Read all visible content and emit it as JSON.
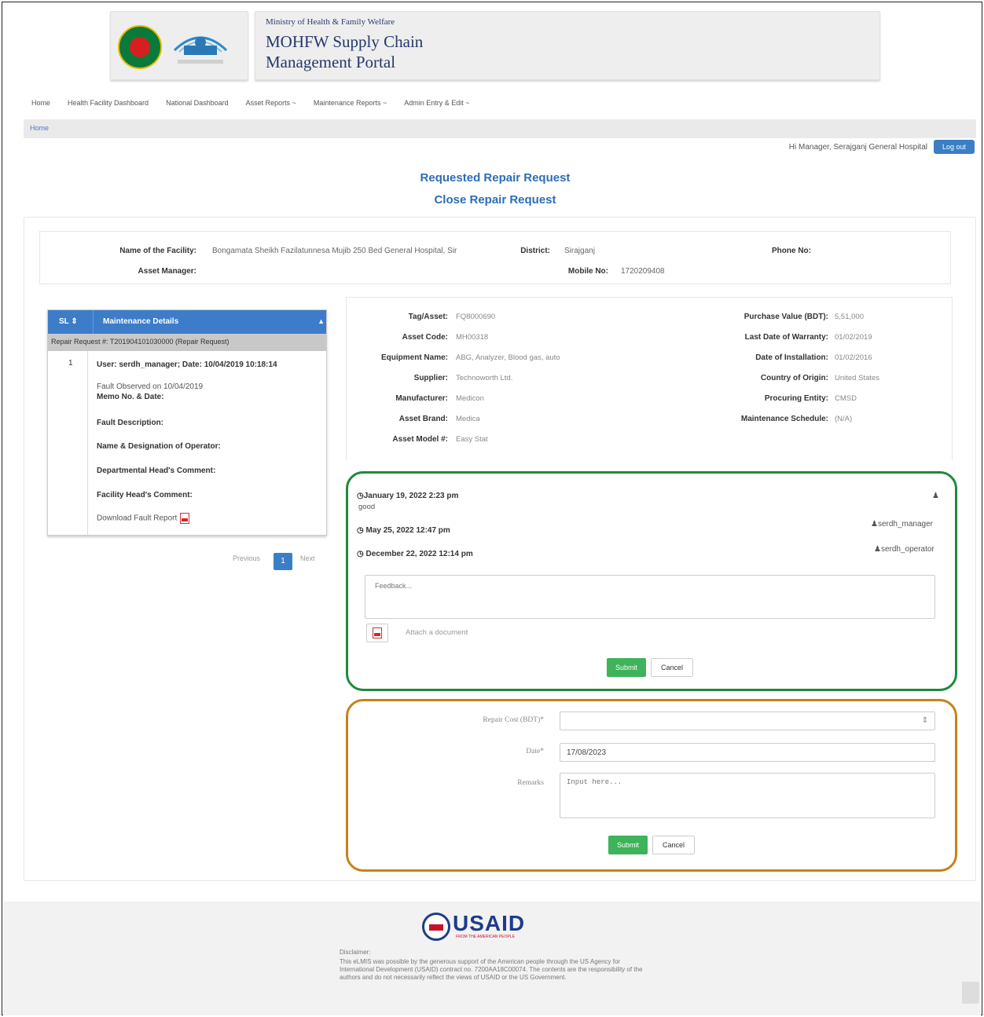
{
  "header": {
    "ministry": "Ministry of Health & Family Welfare",
    "portal_title_line1": "MOHFW Supply Chain",
    "portal_title_line2": "Management Portal"
  },
  "nav": {
    "items": [
      "Home",
      "Health Facility Dashboard",
      "National Dashboard",
      "Asset Reports ~",
      "Maintenance Reports ~",
      "Admin Entry & Edit ~"
    ]
  },
  "breadcrumb": "Home",
  "user": {
    "greeting": "Hi Manager, Serajganj General Hospital",
    "logout": "Log out"
  },
  "page": {
    "title1": "Requested Repair Request",
    "title2": "Close Repair Request"
  },
  "facility": {
    "name_label": "Name of the Facility:",
    "name_value": "Bongamata Sheikh Fazilatunnesa Mujib 250 Bed General Hospital, Sir",
    "district_label": "District:",
    "district_value": "Sirajganj",
    "phone_label": "Phone No:",
    "manager_label": "Asset Manager:",
    "mobile_label": "Mobile No:",
    "mobile_value": "1720209408"
  },
  "maintenance_table": {
    "col_sl": "SL ⇕",
    "col_details": "Maintenance Details",
    "group": "Repair Request #: T201904101030000 (Repair Request)",
    "row_num": "1",
    "user_line": "User: serdh_manager; Date: 10/04/2019 10:18:14",
    "fault_observed": "Fault Observed on 10/04/2019",
    "memo": "Memo No. & Date:",
    "fault_desc": "Fault Description:",
    "operator": "Name & Designation of Operator:",
    "dept_head": "Departmental Head's Comment:",
    "facility_head": "Facility Head's Comment:",
    "download": "Download Fault Report"
  },
  "pager": {
    "previous": "Previous",
    "current": "1",
    "next": "Next"
  },
  "asset": {
    "tag_label": "Tag/Asset:",
    "tag_value": "FQ8000690",
    "code_label": "Asset Code:",
    "code_value": "MH00318",
    "equipment_label": "Equipment Name:",
    "equipment_value": "ABG, Analyzer, Blood gas, auto",
    "supplier_label": "Supplier:",
    "supplier_value": "Technoworth Ltd.",
    "manufacturer_label": "Manufacturer:",
    "manufacturer_value": "Medicon",
    "brand_label": "Asset Brand:",
    "brand_value": "Medica",
    "model_label": "Asset Model #:",
    "model_value": "Easy Stat",
    "purchase_label": "Purchase Value (BDT):",
    "purchase_value": "5,51,000",
    "warranty_label": "Last Date of Warranty:",
    "warranty_value": "01/02/2019",
    "installation_label": "Date of Installation:",
    "installation_value": "01/02/2016",
    "origin_label": "Country of Origin:",
    "origin_value": "United States",
    "procuring_label": "Procuring Entity:",
    "procuring_value": "CMSD",
    "schedule_label": "Maintenance Schedule:",
    "schedule_value": "(N/A)"
  },
  "comments": [
    {
      "date": "January 19, 2022 2:23 pm",
      "text": "good",
      "user": ""
    },
    {
      "date": "May 25, 2022 12:47 pm",
      "text": "",
      "user": "serdh_manager"
    },
    {
      "date": "December 22, 2022 12:14 pm",
      "text": "",
      "user": "serdh_operator"
    }
  ],
  "feedback": {
    "placeholder": "Feedback...",
    "attach_label": "Attach a document",
    "submit": "Submit",
    "cancel": "Cancel"
  },
  "repair_form": {
    "cost_label": "Repair Cost (BDT)*",
    "date_label": "Date*",
    "date_value": "17/08/2023",
    "remarks_label": "Remarks",
    "remarks_placeholder": "Input here...",
    "submit": "Submit",
    "cancel": "Cancel"
  },
  "footer": {
    "usaid": "USAID",
    "usaid_tagline": "FROM THE AMERICAN PEOPLE",
    "disclaimer_title": "Disclaimer:",
    "disclaimer_text": "This eLMIS was possible by the generous support of the American people through the US Agency for International Development (USAID) contract no. 7200AA18C00074. The contents are the responsibility of the authors and do not necessarily reflect the views of USAID or the US Government."
  },
  "colors": {
    "primary": "#3a7fc6",
    "success": "#3db35a",
    "highlight_green": "#1e8a3c",
    "highlight_orange": "#c7821c"
  }
}
